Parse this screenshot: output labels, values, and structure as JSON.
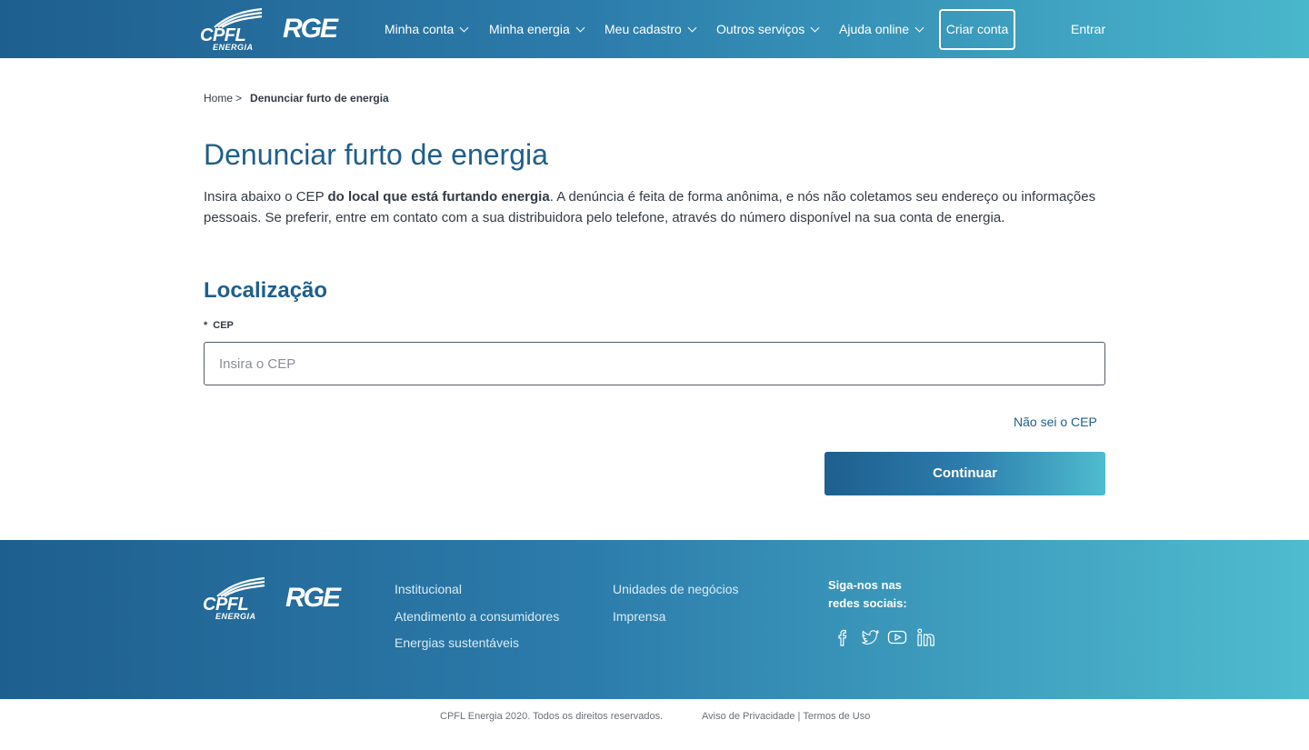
{
  "header": {
    "logo_cpfl": "CPFL",
    "logo_cpfl_sub": "ENERGIA",
    "logo_rge": "RGE",
    "nav": [
      {
        "label": "Minha conta"
      },
      {
        "label": "Minha energia"
      },
      {
        "label": "Meu cadastro"
      },
      {
        "label": "Outros serviços"
      },
      {
        "label": "Ajuda online"
      }
    ],
    "criar_conta": "Criar conta",
    "entrar": "Entrar"
  },
  "breadcrumb": {
    "home": "Home",
    "separator": ">",
    "current": "Denunciar furto de energia"
  },
  "page": {
    "title": "Denunciar furto de energia",
    "intro_start": "Insira abaixo o CEP ",
    "intro_bold": "do local que está furtando energia",
    "intro_end": ". A denúncia é feita de forma anônima, e nós não coletamos seu endereço ou informações pessoais. Se preferir, entre em contato com a sua distribuidora pelo telefone, através do número disponível na sua conta de energia.",
    "section_title": "Localização",
    "cep_required": "*",
    "cep_label": "CEP",
    "cep_placeholder": "Insira o CEP",
    "cep_value": "",
    "nao_sei": "Não sei o CEP",
    "continuar": "Continuar"
  },
  "footer": {
    "links_col1": [
      "Institucional",
      "Atendimento a consumidores",
      "Energias sustentáveis"
    ],
    "links_col2": [
      "Unidades de negócios",
      "Imprensa"
    ],
    "social_title": "Siga-nos nas redes sociais:",
    "social_icons": [
      "facebook-icon",
      "twitter-icon",
      "youtube-icon",
      "linkedin-icon"
    ],
    "copyright": "CPFL Energia 2020. Todos os direitos reservados.",
    "privacy": "Aviso de Privacidade",
    "pipe": "|",
    "terms": "Termos de Uso"
  },
  "colors": {
    "brand_dark": "#1e5f8f",
    "brand_light": "#4fbccf",
    "title_blue": "#1f5f8b"
  }
}
